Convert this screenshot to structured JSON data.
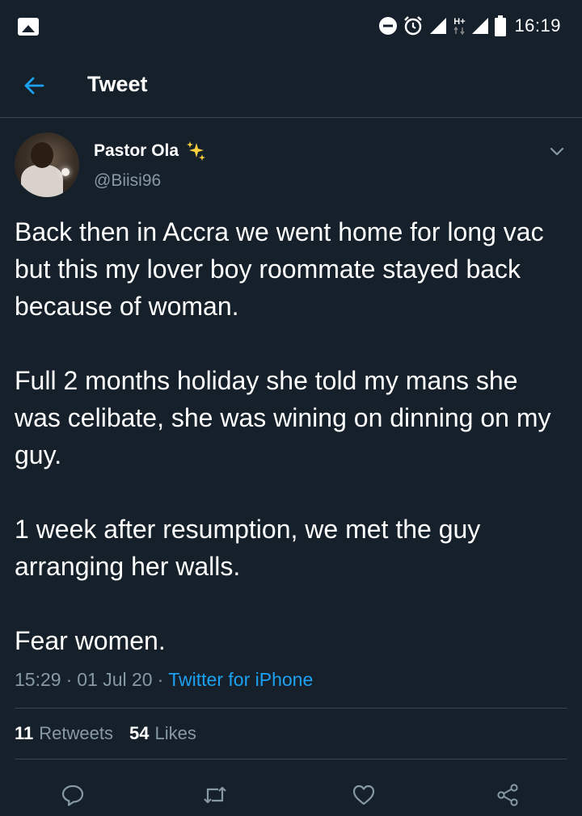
{
  "status_bar": {
    "time": "16:19",
    "network": "H+",
    "icons": [
      "gallery-icon",
      "dnd-icon",
      "alarm-icon",
      "signal-icon",
      "signal-icon",
      "battery-icon"
    ]
  },
  "header": {
    "title": "Tweet",
    "back_icon": "arrow-left-icon"
  },
  "tweet": {
    "author": {
      "name": "Pastor Ola",
      "badge_icon": "sparkles-icon",
      "handle": "@Biisi96"
    },
    "paragraphs": [
      "Back then in Accra we went home for long vac but this my lover boy roommate stayed back because of woman.",
      "Full 2 months holiday she told my mans she was celibate, she was wining on dinning on my guy.",
      "1 week after resumption, we met the guy arranging her walls.",
      "Fear women."
    ],
    "time": "15:29",
    "date": "01 Jul 20",
    "separator": "·",
    "source": "Twitter for iPhone",
    "retweets_count": "11",
    "retweets_label": "Retweets",
    "likes_count": "54",
    "likes_label": "Likes"
  },
  "actions": [
    "reply-icon",
    "retweet-icon",
    "like-icon",
    "share-icon"
  ],
  "colors": {
    "background": "#15202b",
    "divider": "#38444d",
    "secondary_text": "#8899a6",
    "accent": "#1da1f2",
    "sparkle": "#ffd23c"
  }
}
